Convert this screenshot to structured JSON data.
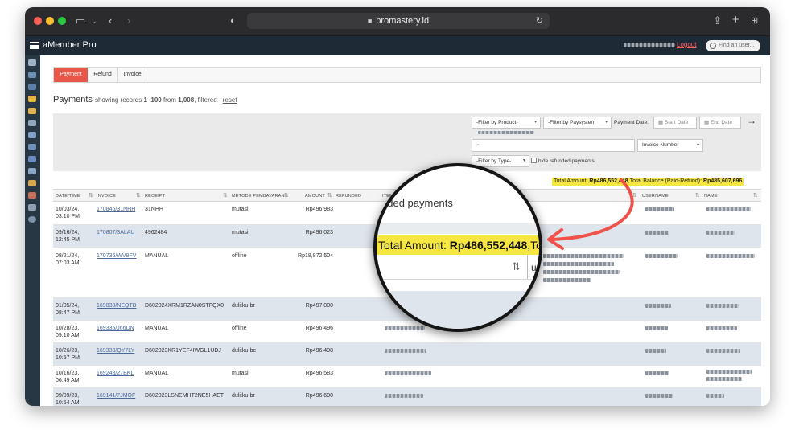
{
  "browser": {
    "url": "promastery.id"
  },
  "app": {
    "name": "aMember Pro",
    "logout": "Logout",
    "find_placeholder": "Find an user..."
  },
  "tabs": [
    {
      "label": "Payment"
    },
    {
      "label": "Refund"
    },
    {
      "label": "Invoice"
    }
  ],
  "heading": {
    "title": "Payments",
    "showing": "showing records",
    "range": "1–100",
    "from": "from",
    "total": "1,008",
    "filtered": ", filtered -",
    "reset": "reset"
  },
  "filters": {
    "product": "-Filter by Product-",
    "paysystem": "-Filter by Paysysten",
    "payment_date_label": "Payment Date:",
    "start_date": "Start Date",
    "end_date": "End Date",
    "invoice_number": "Invoice Number",
    "type": "-Filter by Type-",
    "hide_refunded": "hide refunded payments"
  },
  "totals": {
    "label1": "Total Amount: ",
    "amount": "Rp486,552,448",
    "label2": ",Total Balance (Paid-Refund): ",
    "balance": "Rp485,607,696"
  },
  "table": {
    "headers": [
      "DATE/TIME",
      "INVOICE",
      "RECEIPT",
      "METODE PEMBAYARAN",
      "AMOUNT",
      "REFUNDED",
      "ITEMS",
      "USERNAME",
      "NAME"
    ],
    "rows": [
      {
        "date": "10/03/24,",
        "time": "03:10 PM",
        "invoice": "170846/31NHH",
        "receipt": "31NHH",
        "method": "mutasi",
        "amount": "Rp496,983"
      },
      {
        "date": "09/16/24,",
        "time": "12:45 PM",
        "invoice": "170807/3ALAU",
        "receipt": "4962484",
        "method": "mutasi",
        "amount": "Rp496,023"
      },
      {
        "date": "08/21/24,",
        "time": "07:03 AM",
        "invoice": "170736/WV9FV",
        "receipt": "MANUAL",
        "method": "offline",
        "amount": "Rp18,872,504"
      },
      {
        "date": "01/05/24,",
        "time": "08:47 PM",
        "invoice": "169830/NEQTB",
        "receipt": "D602024XRM1RZAN0STFQX0",
        "method": "dulitku-br",
        "amount": "Rp497,000"
      },
      {
        "date": "10/28/23,",
        "time": "09:10 AM",
        "invoice": "169335/J66DN",
        "receipt": "MANUAL",
        "method": "offline",
        "amount": "Rp496,496"
      },
      {
        "date": "10/26/23,",
        "time": "10:57 PM",
        "invoice": "169333/QY7LY",
        "receipt": "D602023KR1YEF4IWGL1UDJ",
        "method": "dulitku-bc",
        "amount": "Rp496,498"
      },
      {
        "date": "10/16/23,",
        "time": "06:49 AM",
        "invoice": "169248/27BKL",
        "receipt": "MANUAL",
        "method": "mutasi",
        "amount": "Rp496,583"
      },
      {
        "date": "09/09/23,",
        "time": "10:54 AM",
        "invoice": "169141/7JMQF",
        "receipt": "D602023LSNEMHT2NE5HAET",
        "method": "dulitku-br",
        "amount": "Rp496,690"
      }
    ]
  },
  "magnifier": {
    "line1": "nded payments",
    "total_label": "Total Amount: ",
    "total_amount": "Rp486,552,448",
    "total_suffix": ",Tota",
    "col_text": "us"
  },
  "colors": {
    "accent": "#e8564a",
    "highlight": "#f5e642",
    "appbar": "#1e2a36",
    "arrow": "#f0514a"
  }
}
